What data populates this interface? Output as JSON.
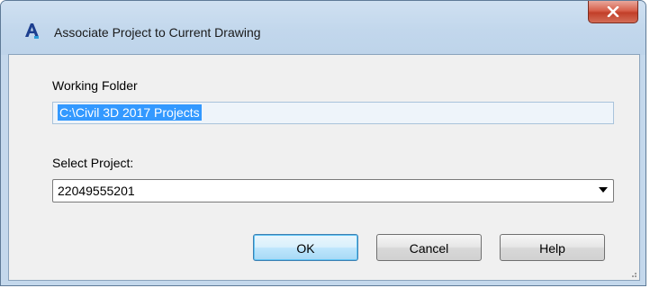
{
  "dialog": {
    "title": "Associate Project to Current Drawing",
    "icon": "autocad-app-icon",
    "close_icon": "close-icon"
  },
  "working_folder": {
    "label": "Working Folder",
    "value": "C:\\Civil 3D 2017 Projects"
  },
  "select_project": {
    "label": "Select Project:",
    "selected": "22049555201"
  },
  "buttons": {
    "ok": "OK",
    "cancel": "Cancel",
    "help": "Help"
  },
  "colors": {
    "selection_highlight": "#3399ff",
    "close_button": "#c94a35",
    "window_frame": "#c4d8ec",
    "client_background": "#f0f0f0"
  }
}
